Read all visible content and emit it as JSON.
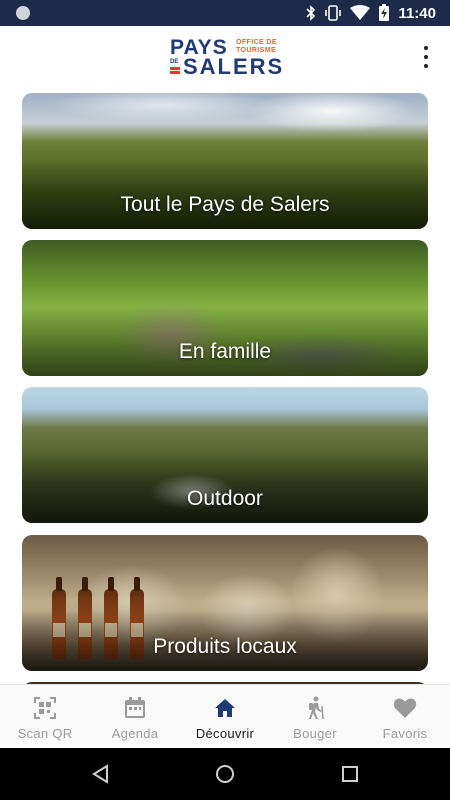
{
  "status_bar": {
    "time": "11:40",
    "icons": [
      "bluetooth-icon",
      "vibrate-icon",
      "wifi-icon",
      "battery-charging-icon"
    ],
    "background": "#1e2a4a"
  },
  "header": {
    "logo_line1": "PAYS",
    "logo_tagline_1": "OFFICE DE",
    "logo_tagline_2": "TOURISME",
    "logo_de": "DE",
    "logo_line2": "SALERS",
    "logo_color": "#1f3a75",
    "accent_color": "#e5672a",
    "menu_icon": "more-vert-icon"
  },
  "categories": [
    {
      "label": "Tout le Pays de Salers"
    },
    {
      "label": "En famille"
    },
    {
      "label": "Outdoor"
    },
    {
      "label": "Produits locaux"
    }
  ],
  "bottom_nav": {
    "items": [
      {
        "label": "Scan QR",
        "icon": "qr-code-icon",
        "active": false
      },
      {
        "label": "Agenda",
        "icon": "calendar-icon",
        "active": false
      },
      {
        "label": "Découvrir",
        "icon": "home-icon",
        "active": true
      },
      {
        "label": "Bouger",
        "icon": "hiker-icon",
        "active": false
      },
      {
        "label": "Favoris",
        "icon": "heart-icon",
        "active": false
      }
    ],
    "active_color": "#1f3a75",
    "inactive_color": "#9a9a9a"
  },
  "system_nav": {
    "buttons": [
      "back-icon",
      "home-circle-icon",
      "recents-icon"
    ]
  }
}
